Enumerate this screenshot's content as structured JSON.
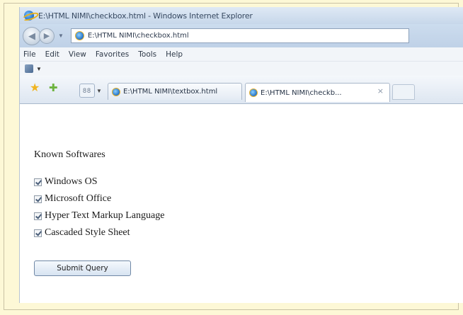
{
  "window": {
    "title": "E:\\HTML NIMI\\checkbox.html - Windows Internet Explorer"
  },
  "address_bar": {
    "url": "E:\\HTML NIMI\\checkbox.html"
  },
  "menu": {
    "items": [
      "File",
      "Edit",
      "View",
      "Favorites",
      "Tools",
      "Help"
    ]
  },
  "tabs": [
    {
      "label": "E:\\HTML NIMI\\textbox.html",
      "active": false
    },
    {
      "label": "E:\\HTML NIMI\\checkb...",
      "active": true
    }
  ],
  "page": {
    "heading": "Known Softwares",
    "checkboxes": [
      {
        "label": "Windows OS",
        "checked": true
      },
      {
        "label": "Microsoft Office",
        "checked": true
      },
      {
        "label": "Hyper Text Markup Language",
        "checked": true
      },
      {
        "label": "Cascaded Style Sheet",
        "checked": true
      }
    ],
    "submit_label": "Submit Query"
  },
  "icons": {
    "close_tab": "×",
    "quick_tabs": "88"
  }
}
